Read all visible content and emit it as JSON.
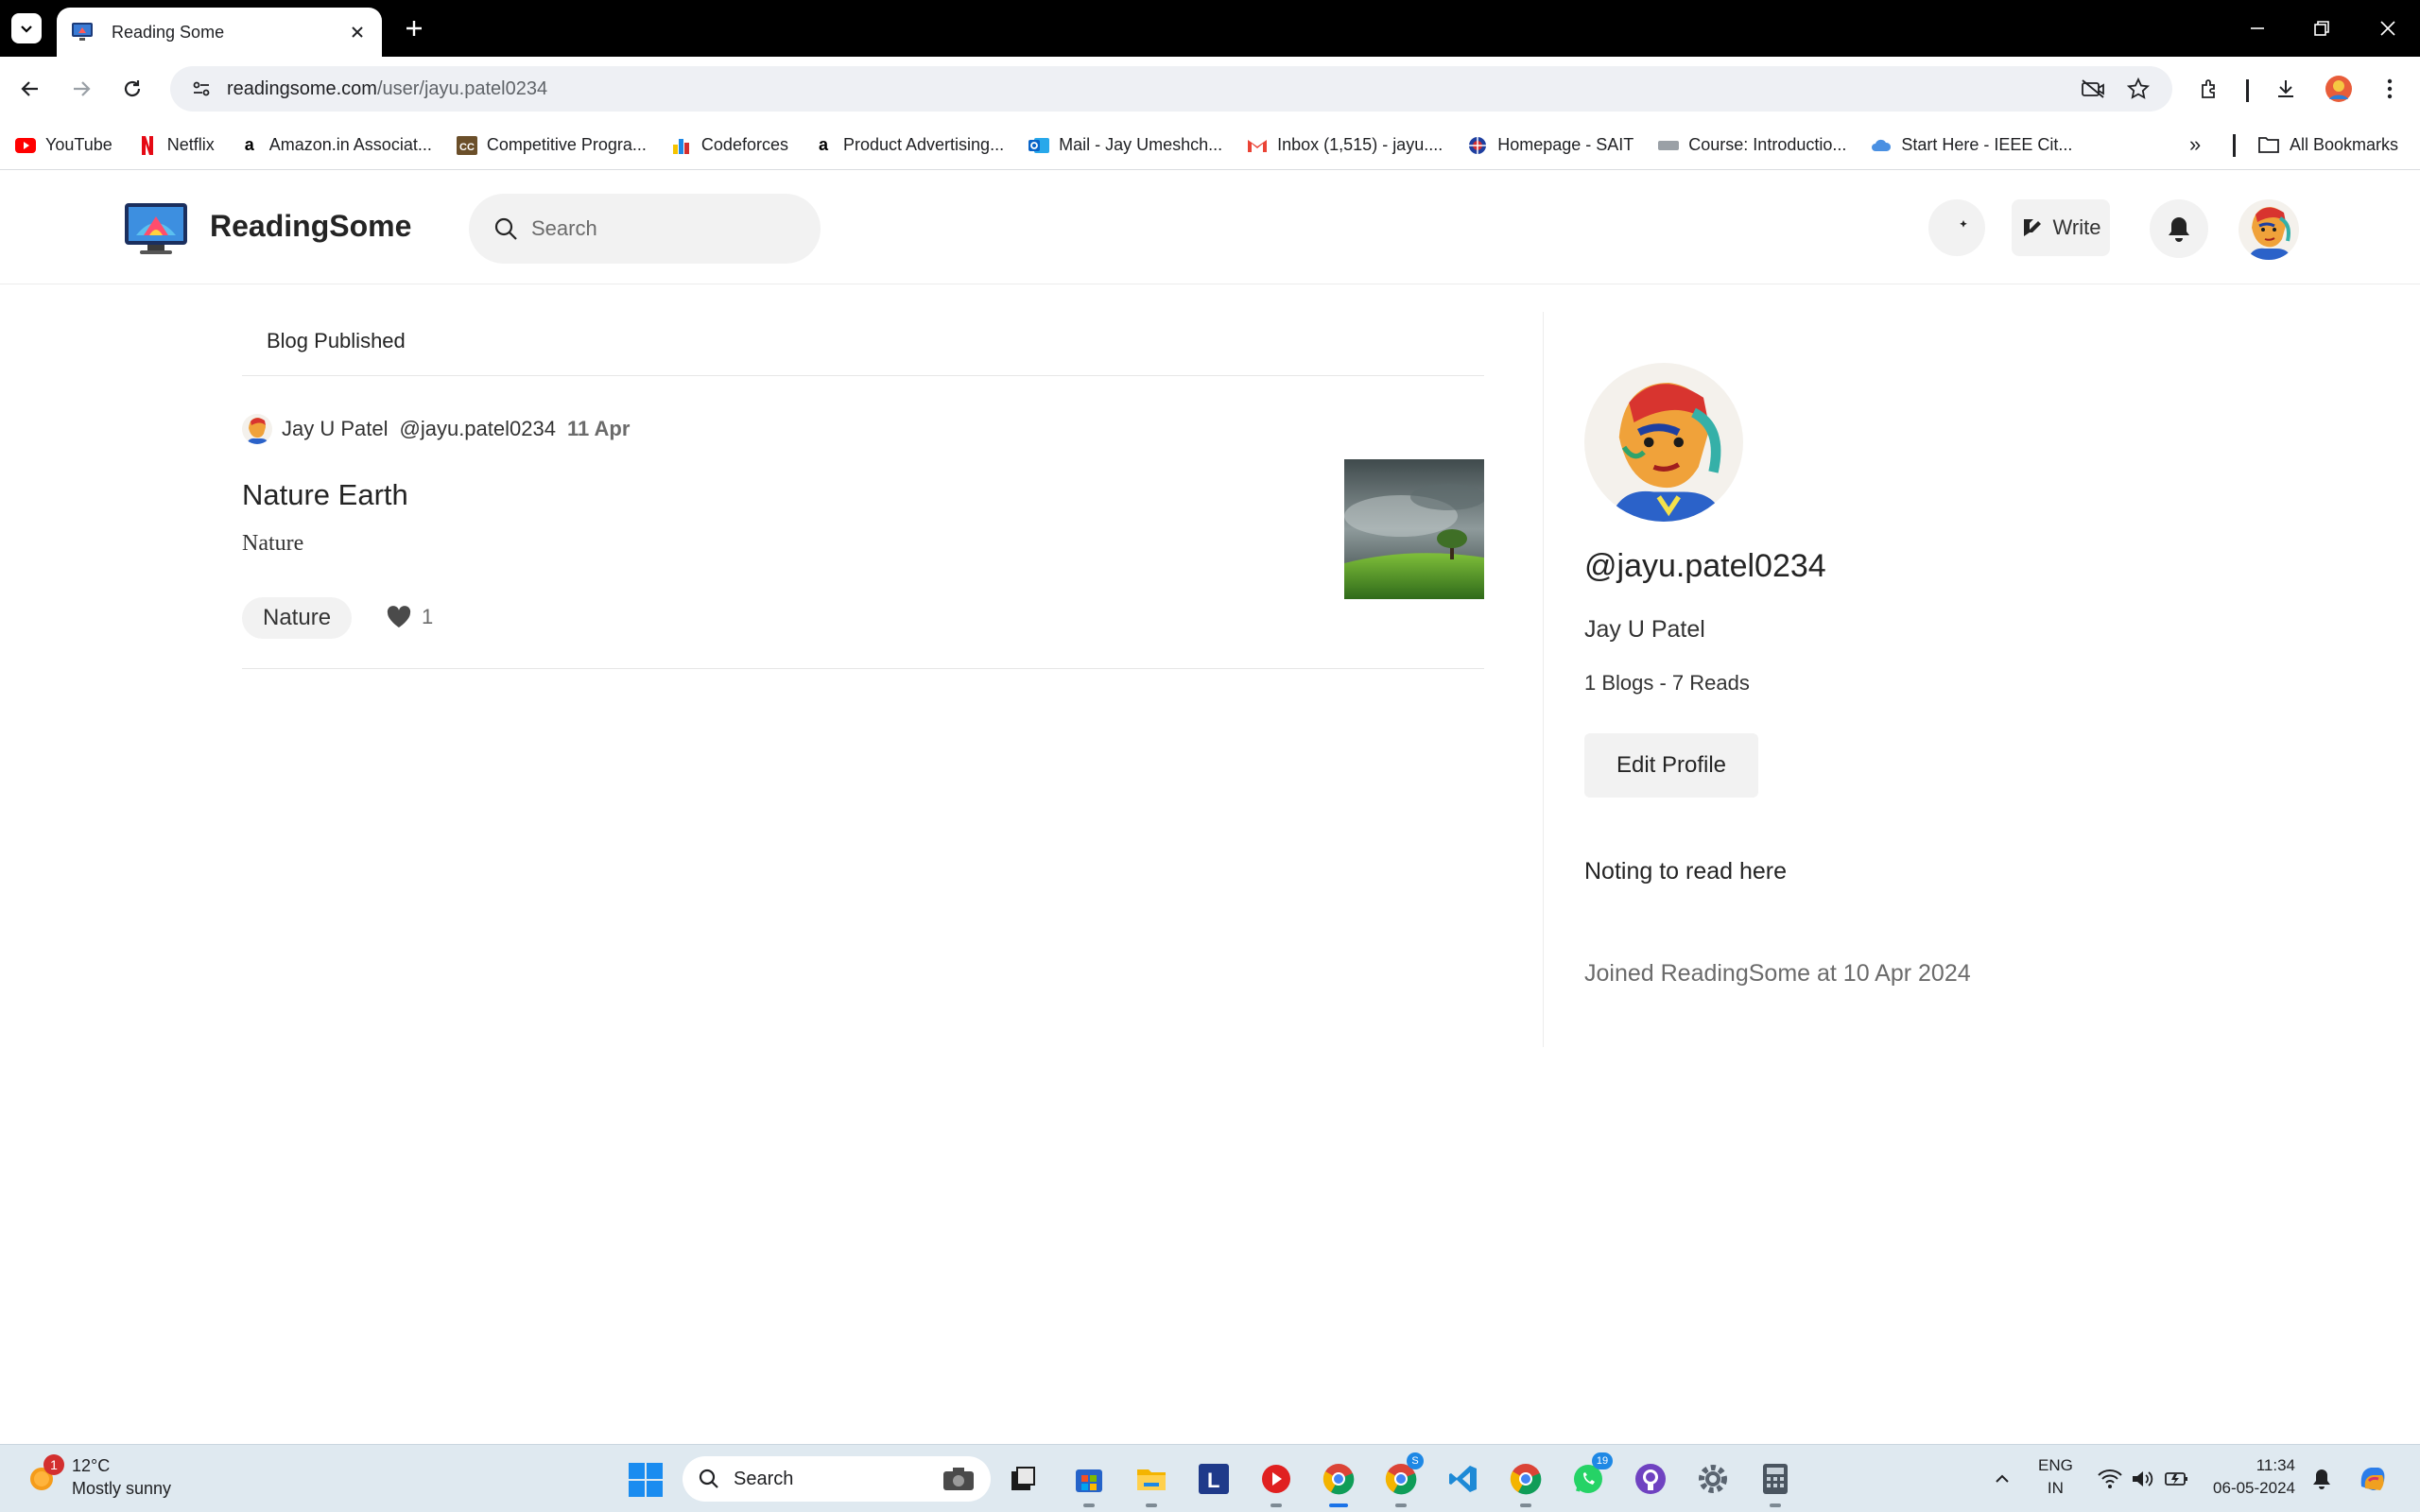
{
  "browser": {
    "tab_title": "Reading Some",
    "url_host": "readingsome.com",
    "url_path": "/user/jayu.patel0234",
    "bookmarks": [
      {
        "label": "YouTube",
        "icon": "youtube-icon",
        "color": "#ff0000"
      },
      {
        "label": "Netflix",
        "icon": "netflix-icon",
        "color": "#e50914"
      },
      {
        "label": "Amazon.in Associat...",
        "icon": "amazon-icon",
        "color": "#000000"
      },
      {
        "label": "Competitive Progra...",
        "icon": "cc-icon",
        "color": "#6b4f2a"
      },
      {
        "label": "Codeforces",
        "icon": "codeforces-icon",
        "color": "#1e88e5"
      },
      {
        "label": "Product Advertising...",
        "icon": "amazon-icon",
        "color": "#000000"
      },
      {
        "label": "Mail - Jay Umeshch...",
        "icon": "outlook-icon",
        "color": "#0a64c8"
      },
      {
        "label": "Inbox (1,515) - jayu....",
        "icon": "gmail-icon",
        "color": "#ea4335"
      },
      {
        "label": "Homepage - SAIT",
        "icon": "sait-icon",
        "color": "#d32f2f"
      },
      {
        "label": "Course: Introductio...",
        "icon": "course-icon",
        "color": "#9aa0a6"
      },
      {
        "label": "Start Here - IEEE Cit...",
        "icon": "cloud-icon",
        "color": "#4a90e2"
      }
    ],
    "all_bookmarks": "All Bookmarks"
  },
  "app": {
    "brand": "ReadingSome",
    "search_placeholder": "Search",
    "write_label": "Write"
  },
  "main": {
    "tab_label": "Blog Published",
    "post": {
      "author_name": "Jay U Patel",
      "author_handle": "@jayu.patel0234",
      "date": "11 Apr",
      "title": "Nature Earth",
      "description": "Nature",
      "tag": "Nature",
      "likes": "1"
    }
  },
  "profile": {
    "handle": "@jayu.patel0234",
    "name": "Jay U Patel",
    "stats": "1 Blogs - 7 Reads",
    "edit_label": "Edit Profile",
    "empty_text": "Noting to read here",
    "joined_text": "Joined ReadingSome at 10 Apr 2024"
  },
  "taskbar": {
    "weather_temp": "12°C",
    "weather_desc": "Mostly sunny",
    "weather_badge": "1",
    "search_label": "Search",
    "lang_top": "ENG",
    "lang_bottom": "IN",
    "time": "11:34",
    "date": "06-05-2024",
    "whatsapp_badge": "19",
    "chrome_badge": "S"
  }
}
